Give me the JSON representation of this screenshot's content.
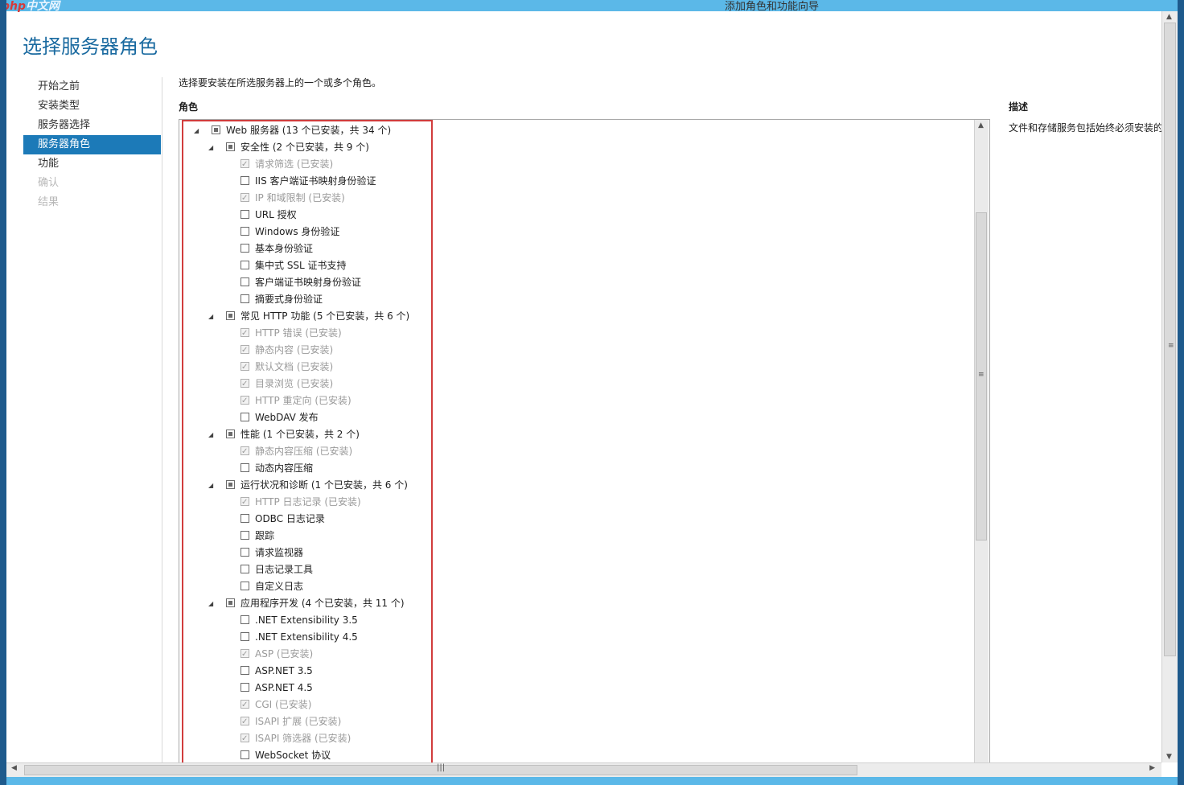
{
  "window": {
    "logo_php": "php",
    "logo_cn": "中文网",
    "title": "添加角色和功能向导"
  },
  "page": {
    "title": "选择服务器角色",
    "instruction": "选择要安装在所选服务器上的一个或多个角色。",
    "roles_label": "角色",
    "description_label": "描述",
    "description_text": "文件和存储服务包括始终必须安装的"
  },
  "nav": {
    "items": [
      {
        "label": "开始之前",
        "state": "normal"
      },
      {
        "label": "安装类型",
        "state": "normal"
      },
      {
        "label": "服务器选择",
        "state": "normal"
      },
      {
        "label": "服务器角色",
        "state": "active"
      },
      {
        "label": "功能",
        "state": "normal"
      },
      {
        "label": "确认",
        "state": "disabled"
      },
      {
        "label": "结果",
        "state": "disabled"
      }
    ]
  },
  "tree": {
    "rows": [
      {
        "level": 0,
        "expander": "◢",
        "check": "partial",
        "installed": false,
        "label": "Web 服务器 (13 个已安装，共 34 个)"
      },
      {
        "level": 1,
        "expander": "◢",
        "check": "partial",
        "installed": false,
        "label": "安全性 (2 个已安装，共 9 个)"
      },
      {
        "level": 2,
        "expander": "",
        "check": "checked",
        "installed": true,
        "label": "请求筛选 (已安装)"
      },
      {
        "level": 2,
        "expander": "",
        "check": "none",
        "installed": false,
        "label": "IIS 客户端证书映射身份验证"
      },
      {
        "level": 2,
        "expander": "",
        "check": "checked",
        "installed": true,
        "label": "IP 和域限制 (已安装)"
      },
      {
        "level": 2,
        "expander": "",
        "check": "none",
        "installed": false,
        "label": "URL 授权"
      },
      {
        "level": 2,
        "expander": "",
        "check": "none",
        "installed": false,
        "label": "Windows 身份验证"
      },
      {
        "level": 2,
        "expander": "",
        "check": "none",
        "installed": false,
        "label": "基本身份验证"
      },
      {
        "level": 2,
        "expander": "",
        "check": "none",
        "installed": false,
        "label": "集中式 SSL 证书支持"
      },
      {
        "level": 2,
        "expander": "",
        "check": "none",
        "installed": false,
        "label": "客户端证书映射身份验证"
      },
      {
        "level": 2,
        "expander": "",
        "check": "none",
        "installed": false,
        "label": "摘要式身份验证"
      },
      {
        "level": 1,
        "expander": "◢",
        "check": "partial",
        "installed": false,
        "label": "常见 HTTP 功能 (5 个已安装，共 6 个)"
      },
      {
        "level": 2,
        "expander": "",
        "check": "checked",
        "installed": true,
        "label": "HTTP 错误 (已安装)"
      },
      {
        "level": 2,
        "expander": "",
        "check": "checked",
        "installed": true,
        "label": "静态内容 (已安装)"
      },
      {
        "level": 2,
        "expander": "",
        "check": "checked",
        "installed": true,
        "label": "默认文档 (已安装)"
      },
      {
        "level": 2,
        "expander": "",
        "check": "checked",
        "installed": true,
        "label": "目录浏览 (已安装)"
      },
      {
        "level": 2,
        "expander": "",
        "check": "checked",
        "installed": true,
        "label": "HTTP 重定向 (已安装)"
      },
      {
        "level": 2,
        "expander": "",
        "check": "none",
        "installed": false,
        "label": "WebDAV 发布"
      },
      {
        "level": 1,
        "expander": "◢",
        "check": "partial",
        "installed": false,
        "label": "性能 (1 个已安装，共 2 个)"
      },
      {
        "level": 2,
        "expander": "",
        "check": "checked",
        "installed": true,
        "label": "静态内容压缩 (已安装)"
      },
      {
        "level": 2,
        "expander": "",
        "check": "none",
        "installed": false,
        "label": "动态内容压缩"
      },
      {
        "level": 1,
        "expander": "◢",
        "check": "partial",
        "installed": false,
        "label": "运行状况和诊断 (1 个已安装，共 6 个)"
      },
      {
        "level": 2,
        "expander": "",
        "check": "checked",
        "installed": true,
        "label": "HTTP 日志记录 (已安装)"
      },
      {
        "level": 2,
        "expander": "",
        "check": "none",
        "installed": false,
        "label": "ODBC 日志记录"
      },
      {
        "level": 2,
        "expander": "",
        "check": "none",
        "installed": false,
        "label": "跟踪"
      },
      {
        "level": 2,
        "expander": "",
        "check": "none",
        "installed": false,
        "label": "请求监视器"
      },
      {
        "level": 2,
        "expander": "",
        "check": "none",
        "installed": false,
        "label": "日志记录工具"
      },
      {
        "level": 2,
        "expander": "",
        "check": "none",
        "installed": false,
        "label": "自定义日志"
      },
      {
        "level": 1,
        "expander": "◢",
        "check": "partial",
        "installed": false,
        "label": "应用程序开发 (4 个已安装，共 11 个)"
      },
      {
        "level": 2,
        "expander": "",
        "check": "none",
        "installed": false,
        "label": ".NET Extensibility 3.5"
      },
      {
        "level": 2,
        "expander": "",
        "check": "none",
        "installed": false,
        "label": ".NET Extensibility 4.5"
      },
      {
        "level": 2,
        "expander": "",
        "check": "checked",
        "installed": true,
        "label": "ASP (已安装)"
      },
      {
        "level": 2,
        "expander": "",
        "check": "none",
        "installed": false,
        "label": "ASP.NET 3.5"
      },
      {
        "level": 2,
        "expander": "",
        "check": "none",
        "installed": false,
        "label": "ASP.NET 4.5"
      },
      {
        "level": 2,
        "expander": "",
        "check": "checked",
        "installed": true,
        "label": "CGI (已安装)"
      },
      {
        "level": 2,
        "expander": "",
        "check": "checked",
        "installed": true,
        "label": "ISAPI 扩展 (已安装)"
      },
      {
        "level": 2,
        "expander": "",
        "check": "checked",
        "installed": true,
        "label": "ISAPI 筛选器 (已安装)"
      },
      {
        "level": 2,
        "expander": "",
        "check": "none",
        "installed": false,
        "label": "WebSocket 协议"
      }
    ]
  },
  "icons": {
    "expander": "triangle-expanded-icon",
    "scroll_up": "▲",
    "scroll_down": "▼",
    "scroll_left": "◀",
    "scroll_right": "▶",
    "grip_v": "≡",
    "grip_h": "|||"
  },
  "colors": {
    "accent": "#1c7ab8",
    "title_bar": "#5bb8e8",
    "highlight_box": "#d13d3d",
    "installed_text": "#9a9a9a"
  }
}
